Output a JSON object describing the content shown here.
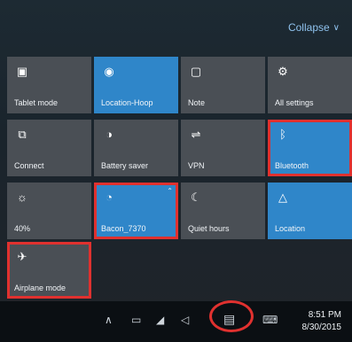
{
  "header": {
    "collapse_label": "Collapse"
  },
  "tiles": [
    {
      "label": "Tablet mode",
      "icon": "tablet-mode-icon",
      "glyph": "▣",
      "state": "off"
    },
    {
      "label": "Location-Hoop",
      "icon": "location-icon",
      "glyph": "◉",
      "state": "on"
    },
    {
      "label": "Note",
      "icon": "note-icon",
      "glyph": "▢",
      "state": "off"
    },
    {
      "label": "All settings",
      "icon": "gear-icon",
      "glyph": "⚙",
      "state": "off"
    },
    {
      "label": "Connect",
      "icon": "connect-icon",
      "glyph": "⧉",
      "state": "off"
    },
    {
      "label": "Battery saver",
      "icon": "battery-saver-icon",
      "glyph": "◑",
      "state": "off"
    },
    {
      "label": "VPN",
      "icon": "vpn-icon",
      "glyph": "⇌",
      "state": "off"
    },
    {
      "label": "Bluetooth",
      "icon": "bluetooth-icon",
      "glyph": "ᛒ",
      "state": "on",
      "highlighted": true
    },
    {
      "label": "40%",
      "icon": "brightness-icon",
      "glyph": "☼",
      "state": "off"
    },
    {
      "label": "Bacon_7370",
      "icon": "wifi-icon",
      "glyph": "◔",
      "state": "on",
      "highlighted": true
    },
    {
      "label": "Quiet hours",
      "icon": "quiet-hours-icon",
      "glyph": "☾",
      "state": "off"
    },
    {
      "label": "Location",
      "icon": "location-alt-icon",
      "glyph": "△",
      "state": "on"
    },
    {
      "label": "Airplane mode",
      "icon": "airplane-icon",
      "glyph": "✈",
      "state": "off",
      "highlighted": true
    }
  ],
  "taskbar": {
    "time": "8:51 PM",
    "date": "8/30/2015",
    "icons": [
      "chevron-up-icon",
      "battery-icon",
      "network-icon",
      "volume-icon",
      "action-center-icon",
      "keyboard-icon"
    ]
  },
  "colors": {
    "tile_off": "#4a4f55",
    "tile_on": "#2f86c9",
    "highlight": "#e0312f",
    "accent_text": "#8fc2ee"
  }
}
